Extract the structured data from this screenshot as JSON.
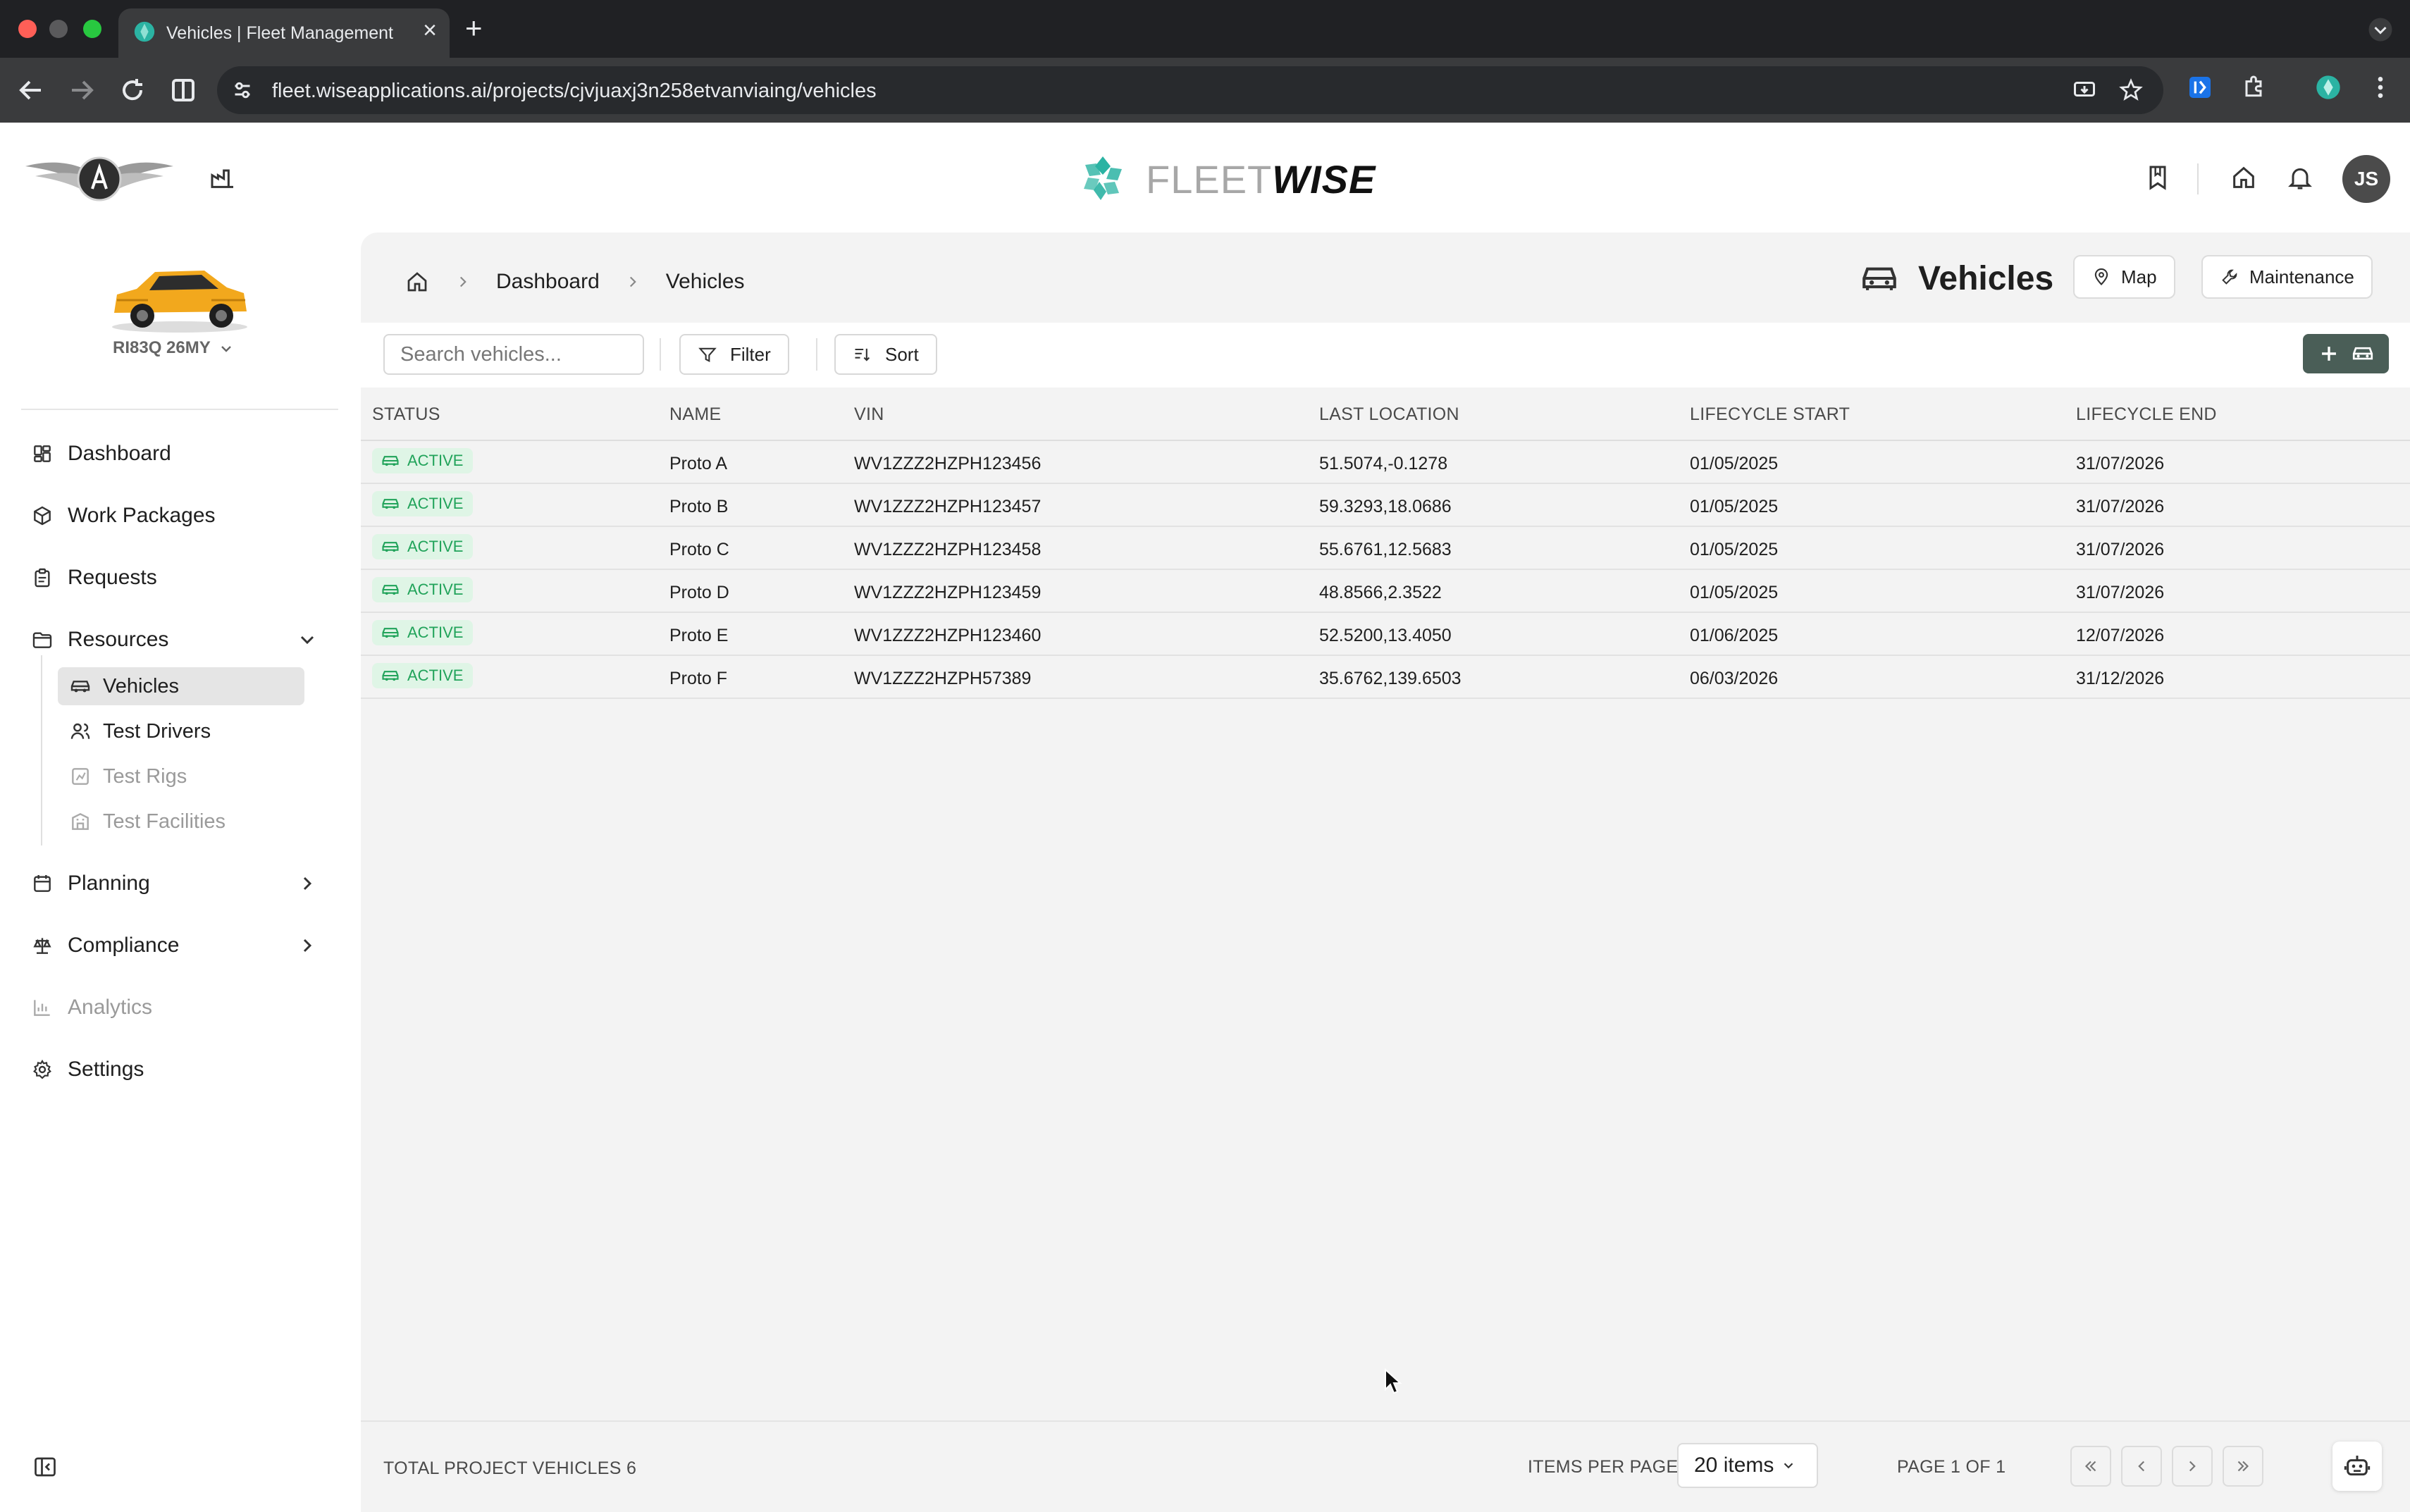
{
  "browser": {
    "tab_title": "Vehicles | Fleet Management",
    "url": "fleet.wiseapplications.ai/projects/cjvjuaxj3n258etvanviaing/vehicles"
  },
  "header": {
    "brand_light": "FLEET",
    "brand_bold": "WISE",
    "avatar_initials": "JS"
  },
  "sidebar": {
    "vehicle_select": "RI83Q 26MY",
    "items": {
      "dashboard": "Dashboard",
      "work_packages": "Work Packages",
      "requests": "Requests",
      "resources": "Resources",
      "planning": "Planning",
      "compliance": "Compliance",
      "analytics": "Analytics",
      "settings": "Settings"
    },
    "resources_sub": {
      "vehicles": "Vehicles",
      "test_drivers": "Test Drivers",
      "test_rigs": "Test Rigs",
      "test_facilities": "Test Facilities"
    }
  },
  "main": {
    "breadcrumb": [
      "Dashboard",
      "Vehicles"
    ],
    "title": "Vehicles",
    "map_button": "Map",
    "maintenance_button": "Maintenance",
    "search_placeholder": "Search vehicles...",
    "filter_button": "Filter",
    "sort_button": "Sort"
  },
  "table": {
    "headers": [
      "STATUS",
      "NAME",
      "VIN",
      "LAST LOCATION",
      "LIFECYCLE START",
      "LIFECYCLE END"
    ],
    "rows": [
      {
        "status": "ACTIVE",
        "name": "Proto A",
        "vin": "WV1ZZZ2HZPH123456",
        "location": "51.5074,-0.1278",
        "start": "01/05/2025",
        "end": "31/07/2026"
      },
      {
        "status": "ACTIVE",
        "name": "Proto B",
        "vin": "WV1ZZZ2HZPH123457",
        "location": "59.3293,18.0686",
        "start": "01/05/2025",
        "end": "31/07/2026"
      },
      {
        "status": "ACTIVE",
        "name": "Proto C",
        "vin": "WV1ZZZ2HZPH123458",
        "location": "55.6761,12.5683",
        "start": "01/05/2025",
        "end": "31/07/2026"
      },
      {
        "status": "ACTIVE",
        "name": "Proto D",
        "vin": "WV1ZZZ2HZPH123459",
        "location": "48.8566,2.3522",
        "start": "01/05/2025",
        "end": "31/07/2026"
      },
      {
        "status": "ACTIVE",
        "name": "Proto E",
        "vin": "WV1ZZZ2HZPH123460",
        "location": "52.5200,13.4050",
        "start": "01/06/2025",
        "end": "12/07/2026"
      },
      {
        "status": "ACTIVE",
        "name": "Proto F",
        "vin": "WV1ZZZ2HZPH57389",
        "location": "35.6762,139.6503",
        "start": "06/03/2026",
        "end": "31/12/2026"
      }
    ]
  },
  "footer": {
    "total_label": "TOTAL PROJECT VEHICLES 6",
    "items_per_page_label": "ITEMS PER PAGE",
    "items_per_page_value": "20 items",
    "page_info": "PAGE 1 OF 1"
  },
  "colors": {
    "accent": "#4a5e57",
    "status_active_bg": "#dff5e6",
    "status_active_text": "#21a35a",
    "brand_teal": "#2bb3a3"
  }
}
